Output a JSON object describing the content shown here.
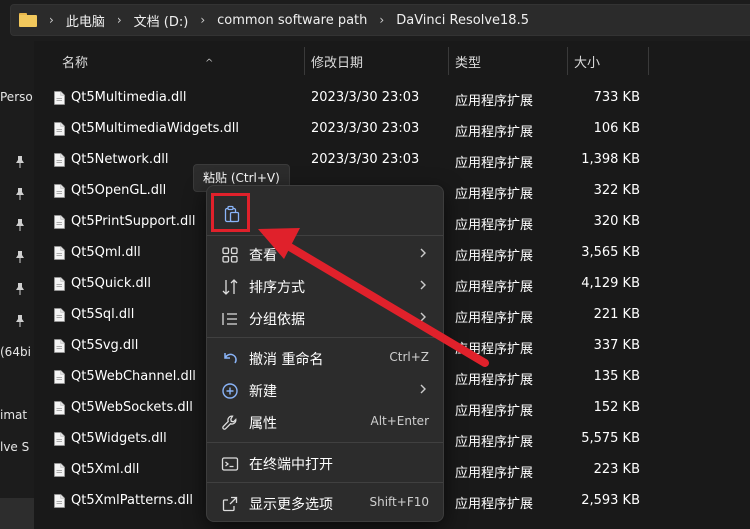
{
  "breadcrumb": {
    "items": [
      "此电脑",
      "文档 (D:)",
      "common software path",
      "DaVinci Resolve18.5"
    ],
    "separator": "›"
  },
  "leftnav": {
    "fragments": [
      "Perso",
      "(64bi",
      "imat",
      "lve S"
    ]
  },
  "columns": {
    "name": "名称",
    "modified": "修改日期",
    "type": "类型",
    "size": "大小",
    "sort_caret": "^"
  },
  "files": [
    {
      "name": "Qt5Multimedia.dll",
      "date": "2023/3/30 23:03",
      "type": "应用程序扩展",
      "size": "733 KB"
    },
    {
      "name": "Qt5MultimediaWidgets.dll",
      "date": "2023/3/30 23:03",
      "type": "应用程序扩展",
      "size": "106 KB"
    },
    {
      "name": "Qt5Network.dll",
      "date": "2023/3/30 23:03",
      "type": "应用程序扩展",
      "size": "1,398 KB"
    },
    {
      "name": "Qt5OpenGL.dll",
      "date": "",
      "type": "应用程序扩展",
      "size": "322 KB"
    },
    {
      "name": "Qt5PrintSupport.dll",
      "date": "",
      "type": "应用程序扩展",
      "size": "320 KB"
    },
    {
      "name": "Qt5Qml.dll",
      "date": "",
      "type": "应用程序扩展",
      "size": "3,565 KB"
    },
    {
      "name": "Qt5Quick.dll",
      "date": "",
      "type": "应用程序扩展",
      "size": "4,129 KB"
    },
    {
      "name": "Qt5Sql.dll",
      "date": "",
      "type": "应用程序扩展",
      "size": "221 KB"
    },
    {
      "name": "Qt5Svg.dll",
      "date": "",
      "type": "应用程序扩展",
      "size": "337 KB"
    },
    {
      "name": "Qt5WebChannel.dll",
      "date": "",
      "type": "应用程序扩展",
      "size": "135 KB"
    },
    {
      "name": "Qt5WebSockets.dll",
      "date": "",
      "type": "应用程序扩展",
      "size": "152 KB"
    },
    {
      "name": "Qt5Widgets.dll",
      "date": "",
      "type": "应用程序扩展",
      "size": "5,575 KB"
    },
    {
      "name": "Qt5Xml.dll",
      "date": "",
      "type": "应用程序扩展",
      "size": "223 KB"
    },
    {
      "name": "Qt5XmlPatterns.dll",
      "date": "",
      "type": "应用程序扩展",
      "size": "2,593 KB"
    }
  ],
  "tooltip": {
    "text": "粘贴 (Ctrl+V)"
  },
  "context_menu": {
    "paste_icon": "paste-icon",
    "items": [
      {
        "label": "查看",
        "icon": "grid-view-icon",
        "shortcut": "",
        "submenu": true
      },
      {
        "label": "排序方式",
        "icon": "sort-icon",
        "shortcut": "",
        "submenu": true
      },
      {
        "label": "分组依据",
        "icon": "group-list-icon",
        "shortcut": "",
        "submenu": true
      },
      {
        "label": "撤消 重命名",
        "icon": "undo-icon",
        "shortcut": "Ctrl+Z",
        "submenu": false
      },
      {
        "label": "新建",
        "icon": "new-plus-icon",
        "shortcut": "",
        "submenu": true
      },
      {
        "label": "属性",
        "icon": "wrench-icon",
        "shortcut": "Alt+Enter",
        "submenu": false
      },
      {
        "label": "在终端中打开",
        "icon": "terminal-icon",
        "shortcut": "",
        "submenu": false
      },
      {
        "label": "显示更多选项",
        "icon": "more-options-icon",
        "shortcut": "Shift+F10",
        "submenu": false
      }
    ]
  },
  "colors": {
    "accent_red": "#e0212b",
    "folder_yellow": "#f2c85c",
    "background": "#191919",
    "menu_bg": "#2c2c2c",
    "icon_blue": "#8ab4f8"
  }
}
